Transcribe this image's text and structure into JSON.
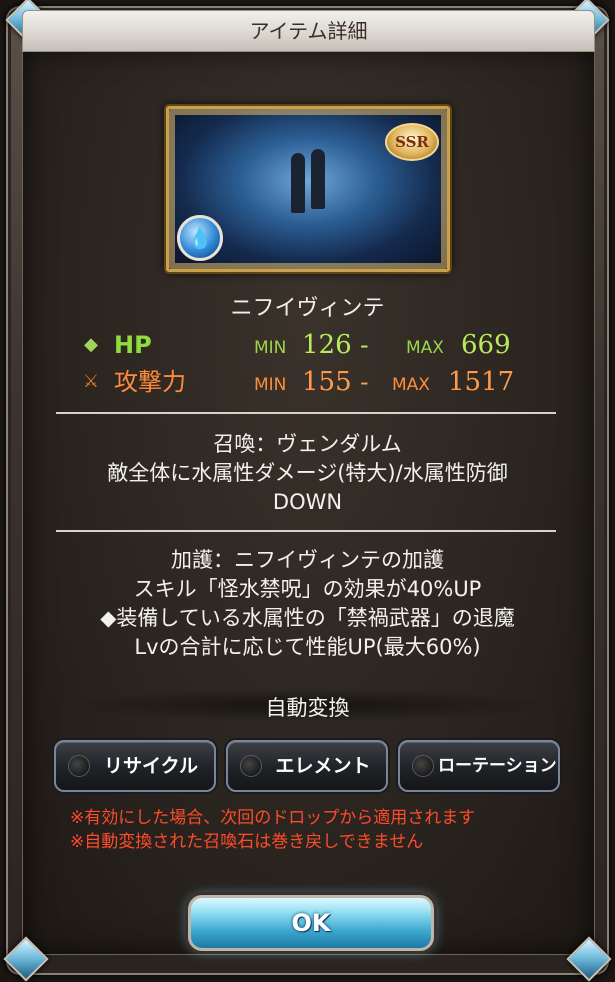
{
  "dialog": {
    "title": "アイテム詳細"
  },
  "summon": {
    "name": "ニフイヴィンテ",
    "rarity": "SSR",
    "element_icon": "water-element-icon",
    "element_color": "#2f87d6"
  },
  "stats": [
    {
      "label": "HP",
      "icon": "hp-diamond-icon",
      "min_label": "MIN",
      "min": "126",
      "sep": "-",
      "max_label": "MAX",
      "max": "669",
      "color": "#8fdc3a"
    },
    {
      "label": "攻撃力",
      "icon": "sword-icon",
      "min_label": "MIN",
      "min": "155",
      "sep": "-",
      "max_label": "MAX",
      "max": "1517",
      "color": "#ff8a3a"
    }
  ],
  "call": {
    "lines": [
      "召喚：ヴェンダルム",
      "敵全体に水属性ダメージ(特大)/水属性防御",
      "DOWN"
    ]
  },
  "aura": {
    "lines": [
      "加護：ニフイヴィンテの加護",
      "スキル「怪水禁呪」の効果が40%UP",
      "◆装備している水属性の「禁禍武器」の退魔",
      "Lvの合計に応じて性能UP(最大60%)"
    ]
  },
  "auto_convert": {
    "title": "自動変換",
    "options": [
      {
        "label": "リサイクル",
        "selected": false
      },
      {
        "label": "エレメント",
        "selected": false
      },
      {
        "label": "ローテーション",
        "selected": false
      }
    ]
  },
  "notes": [
    "※有効にした場合、次回のドロップから適用されます",
    "※自動変換された召喚石は巻き戻しできません"
  ],
  "ok_label": "OK"
}
